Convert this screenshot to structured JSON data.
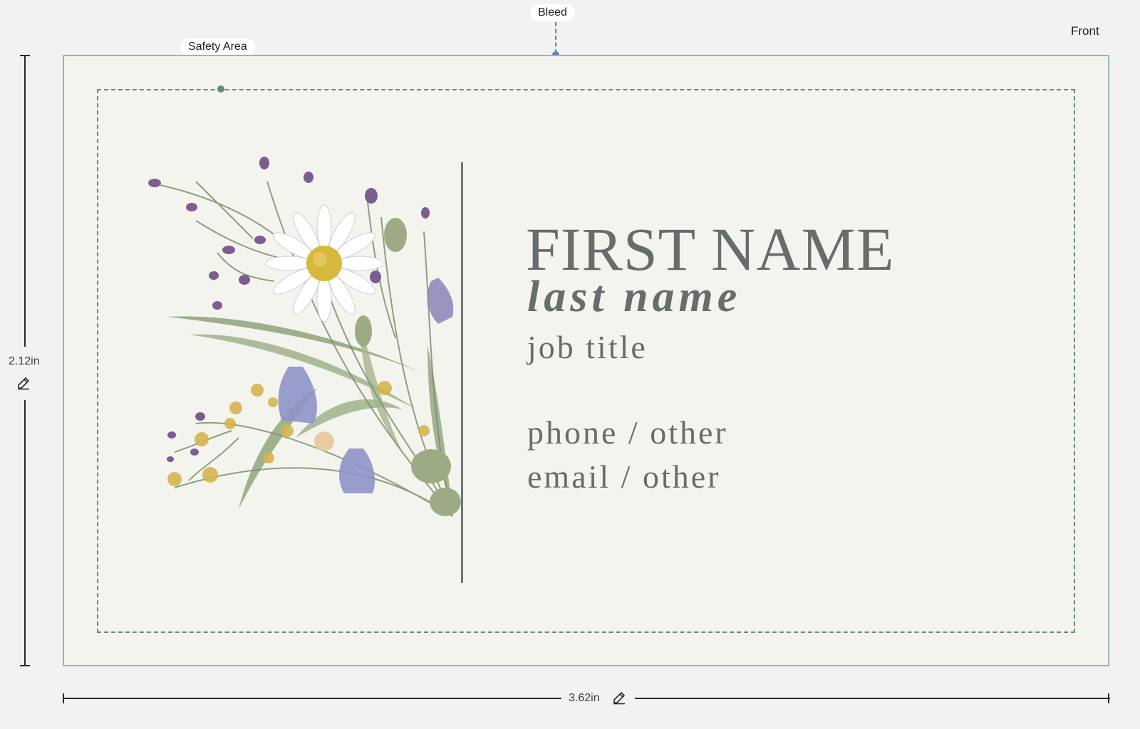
{
  "bleed_label": "Bleed",
  "safety_area_label": "Safety Area",
  "side_label": "Front",
  "card": {
    "first_name": "FIRST NAME",
    "last_name": "last name",
    "job_title": "job title",
    "phone_line": "phone / other",
    "email_line": "email / other"
  },
  "dimensions": {
    "height": "2.12in",
    "width": "3.62in"
  },
  "colors": {
    "bleed_guide": "#5b84b5",
    "safety_guide": "#5f8e74",
    "card_background": "#f4f4ef",
    "text": "#676d6b"
  },
  "icons": {
    "edit": "pencil-icon"
  }
}
